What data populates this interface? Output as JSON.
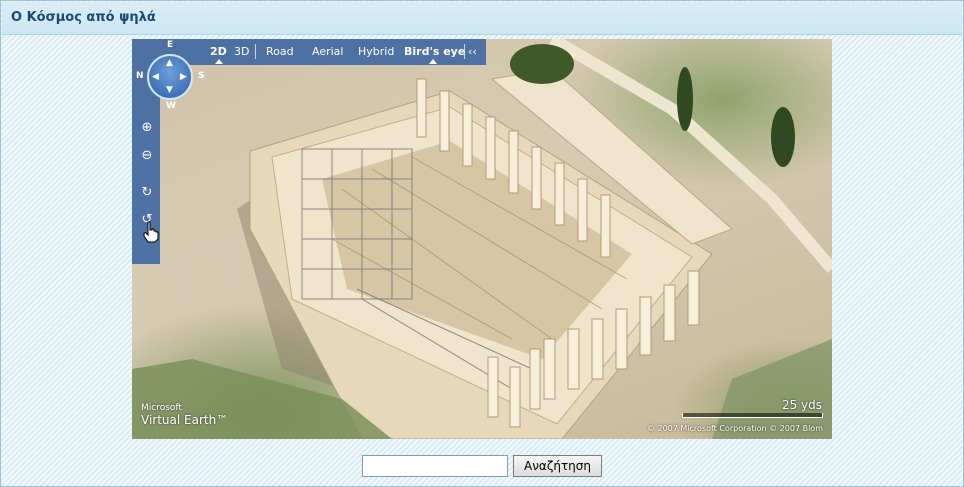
{
  "header": {
    "title": "Ο Κόσμος από ψηλά"
  },
  "map": {
    "compass": {
      "e": "E",
      "n": "N",
      "s": "S",
      "w": "W"
    },
    "controls": {
      "zoom_in": "⊕",
      "zoom_out": "⊖",
      "rotate_cw": "↻",
      "rotate_ccw": "↺"
    },
    "styles": [
      {
        "label": "2D",
        "active": true
      },
      {
        "label": "3D",
        "active": false
      },
      {
        "label": "Road",
        "active": false
      },
      {
        "label": "Aerial",
        "active": false
      },
      {
        "label": "Hybrid",
        "active": false
      },
      {
        "label": "Bird's eye",
        "active": true
      }
    ],
    "collapse": "‹‹",
    "brand": {
      "line1": "Microsoft",
      "line2": "Virtual Earth™"
    },
    "scale_label": "25 yds",
    "copyright": "© 2007 Microsoft Corporation    © 2007 Blom",
    "colors": {
      "panel": "#285aa0",
      "stone": "#e9dcc2",
      "grass": "#7d9460"
    },
    "icons": {
      "cursor": "hand-pointer-icon"
    }
  },
  "search": {
    "value": "",
    "placeholder": "",
    "button_label": "Αναζήτηση"
  }
}
